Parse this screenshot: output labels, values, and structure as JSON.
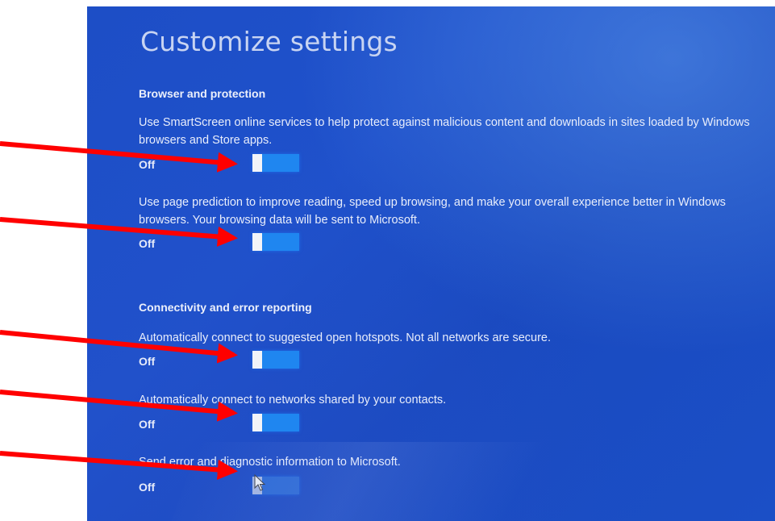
{
  "page_title": "Customize settings",
  "sections": [
    {
      "heading": "Browser and protection",
      "settings": [
        {
          "text": "Use SmartScreen online services to help protect against malicious content and downloads in sites loaded by Windows browsers and Store apps.",
          "state": "Off"
        },
        {
          "text": "Use page prediction to improve reading, speed up browsing, and make your overall experience better in Windows browsers. Your browsing data will be sent to Microsoft.",
          "state": "Off"
        }
      ]
    },
    {
      "heading": "Connectivity and error reporting",
      "settings": [
        {
          "text": "Automatically connect to suggested open hotspots. Not all networks are secure.",
          "state": "Off"
        },
        {
          "text": "Automatically connect to networks shared by your contacts.",
          "state": "Off"
        },
        {
          "text": "Send error and diagnostic information to Microsoft.",
          "state": "Off"
        }
      ]
    }
  ],
  "colors": {
    "screen_background": "#1d4ec6",
    "toggle_track": "#1f86f0",
    "toggle_knob": "#f2f4f8",
    "annotation_arrow": "#ff0000"
  },
  "icons": [
    "mouse-pointer-icon",
    "red-arrow-annotation"
  ]
}
